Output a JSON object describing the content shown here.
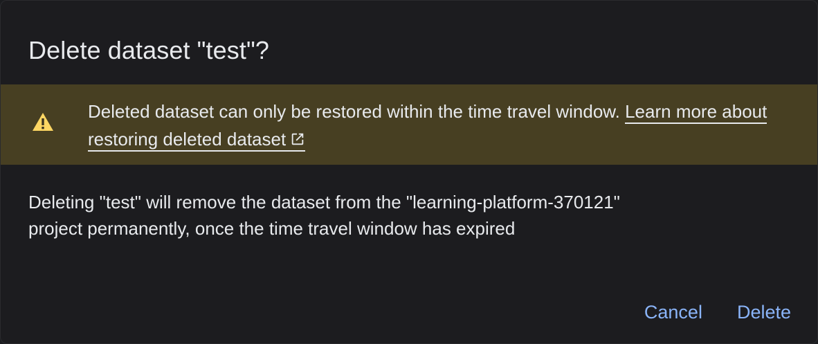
{
  "dialog": {
    "title": "Delete dataset \"test\"?",
    "warning": {
      "icon": "warning-triangle-icon",
      "text": "Deleted dataset can only be restored within the time travel window. ",
      "link_text": "Learn more about restoring deleted dataset",
      "link_icon": "open-in-new-icon"
    },
    "body_line_1": "Deleting \"test\" will remove the dataset from the \"learning-platform-370121\"",
    "body_line_2": "project permanently, once the time travel window has expired",
    "actions": {
      "cancel_label": "Cancel",
      "delete_label": "Delete"
    }
  },
  "colors": {
    "background": "#1c1c1f",
    "warning_background": "#473f22",
    "warning_icon": "#fdd663",
    "text": "#e8eaed",
    "accent": "#8ab4f8"
  }
}
